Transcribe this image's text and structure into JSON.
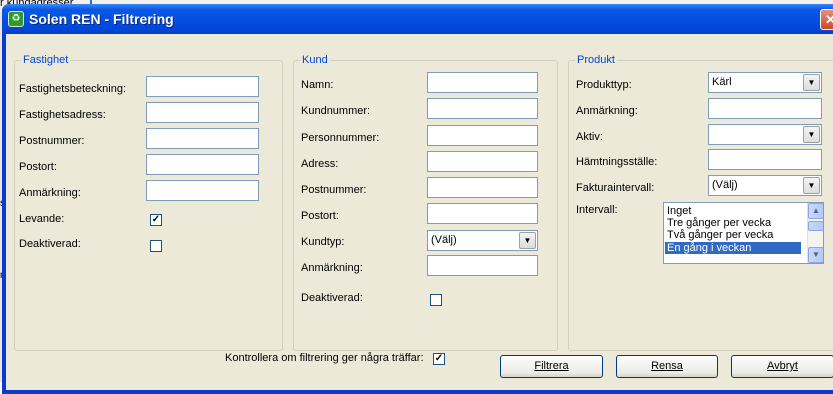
{
  "background": {
    "top_text": "r kundadresser",
    "left_marks": [
      "s",
      "r"
    ]
  },
  "window": {
    "title": "Solen REN - Filtrering",
    "app_icon": "recycle-icon",
    "close_glyph": "✕"
  },
  "fastighet": {
    "legend": "Fastighet",
    "beteckning_label": "Fastighetsbeteckning:",
    "adress_label": "Fastighetsadress:",
    "postnummer_label": "Postnummer:",
    "postort_label": "Postort:",
    "anmarkning_label": "Anmärkning:",
    "levande_label": "Levande:",
    "levande_check": "✓",
    "deaktiverad_label": "Deaktiverad:",
    "deaktiverad_check": ""
  },
  "kund": {
    "legend": "Kund",
    "namn_label": "Namn:",
    "kundnummer_label": "Kundnummer:",
    "personnummer_label": "Personnummer:",
    "adress_label": "Adress:",
    "postnummer_label": "Postnummer:",
    "postort_label": "Postort:",
    "kundtyp_label": "Kundtyp:",
    "kundtyp_value": "(Välj)",
    "anmarkning_label": "Anmärkning:",
    "deaktiverad_label": "Deaktiverad:",
    "deaktiverad_check": ""
  },
  "produkt": {
    "legend": "Produkt",
    "produkttyp_label": "Produkttyp:",
    "produkttyp_value": "Kärl",
    "anmarkning_label": "Anmärkning:",
    "aktiv_label": "Aktiv:",
    "aktiv_value": "",
    "hamtningsstalle_label": "Hämtningsställe:",
    "fakturaintervall_label": "Fakturaintervall:",
    "fakturaintervall_value": "(Välj)",
    "intervall_label": "Intervall:",
    "intervall_options": [
      "Inget",
      "Tre gånger per vecka",
      "Två gånger per vecka",
      "En gång i veckan"
    ],
    "intervall_selected": "En gång i veckan"
  },
  "footer": {
    "kontrollera_label": "Kontrollera om filtrering ger några träffar:",
    "kontrollera_check": "✓",
    "filtrera_button": "Filtrera",
    "rensa_button": "Rensa",
    "avbryt_button": "Avbryt"
  }
}
